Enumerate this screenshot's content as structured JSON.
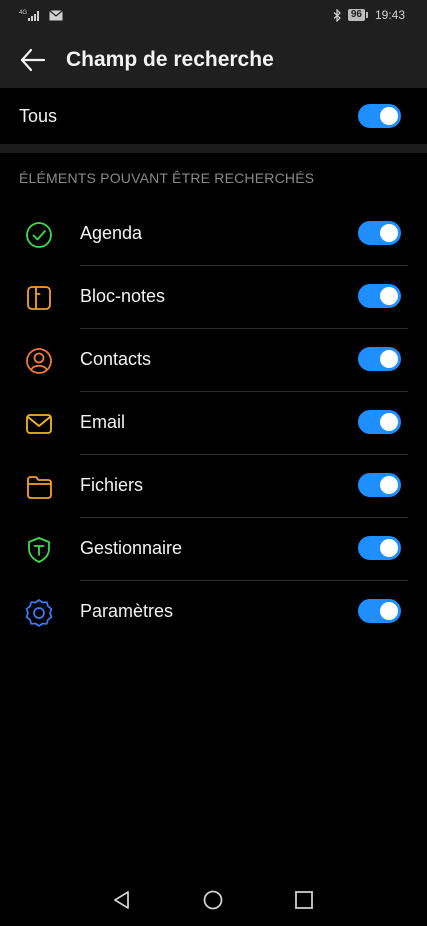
{
  "status_bar": {
    "network_label": "4G",
    "time": "19:43",
    "battery_level": "96",
    "icons": [
      "signal-icon",
      "mail-icon",
      "bluetooth-icon",
      "battery-icon"
    ]
  },
  "app_bar": {
    "title": "Champ de recherche",
    "back_icon": "arrow-left-icon"
  },
  "all_row": {
    "label": "Tous",
    "enabled": true
  },
  "section": {
    "title": "ÉLÉMENTS POUVANT ÊTRE RECHERCHÉS"
  },
  "items": [
    {
      "label": "Agenda",
      "icon": "agenda-icon",
      "color": "#3ddc4a",
      "enabled": true
    },
    {
      "label": "Bloc-notes",
      "icon": "notes-icon",
      "color": "#f2a324",
      "enabled": true
    },
    {
      "label": "Contacts",
      "icon": "contacts-icon",
      "color": "#ef7a3c",
      "enabled": true
    },
    {
      "label": "Email",
      "icon": "email-icon",
      "color": "#f2b526",
      "enabled": true
    },
    {
      "label": "Fichiers",
      "icon": "folder-icon",
      "color": "#f2a324",
      "enabled": true
    },
    {
      "label": "Gestionnaire",
      "icon": "shield-icon",
      "color": "#3ddc4a",
      "enabled": true
    },
    {
      "label": "Paramètres",
      "icon": "settings-icon",
      "color": "#3d7dff",
      "enabled": true
    }
  ],
  "colors": {
    "accent": "#1f8fff",
    "background": "#000000",
    "bar_background": "#1f1f1f"
  },
  "nav_bar": {
    "icons": [
      "back-triangle-icon",
      "home-circle-icon",
      "recents-square-icon"
    ]
  }
}
